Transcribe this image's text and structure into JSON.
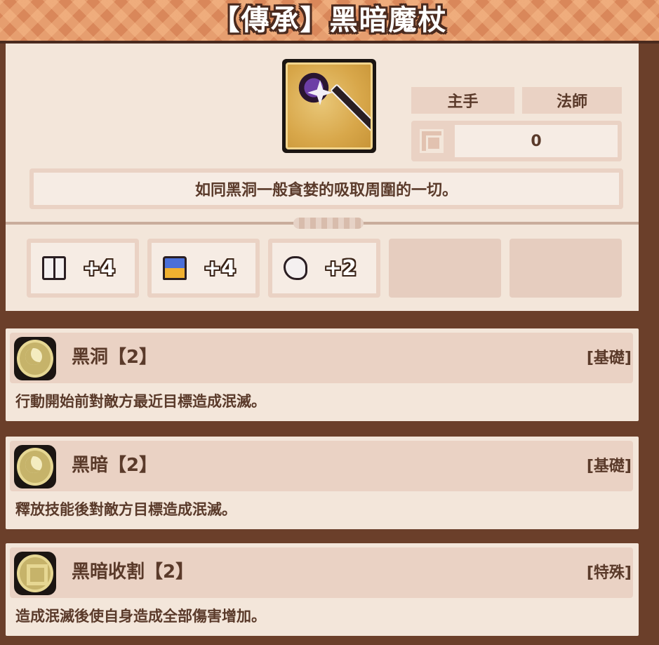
{
  "title": "【傳承】黑暗魔杖",
  "item": {
    "icon": "dark-staff-icon",
    "slot_label": "主手",
    "class_label": "法師",
    "slot_value": "0",
    "description": "如同黑洞一般貪婪的吸取周圍的一切。"
  },
  "stats": [
    {
      "icon": "book-icon",
      "value": "+4"
    },
    {
      "icon": "boot-icon",
      "value": "+4"
    },
    {
      "icon": "glove-icon",
      "value": "+2"
    }
  ],
  "skills": [
    {
      "name": "黑洞【2】",
      "type": "[基礎]",
      "description": "行動開始前對敵方最近目標造成泯滅。",
      "icon": "moon-icon"
    },
    {
      "name": "黑暗【2】",
      "type": "[基礎]",
      "description": "釋放技能後對敵方目標造成泯滅。",
      "icon": "moon-icon"
    },
    {
      "name": "黑暗收割【2】",
      "type": "[特殊]",
      "description": "造成泯滅後使自身造成全部傷害增加。",
      "icon": "ring-icon"
    }
  ],
  "colors": {
    "banner": "#d9875a",
    "card": "#f3e6da",
    "text": "#5a3a2a",
    "frame": "#6b3f2a"
  }
}
